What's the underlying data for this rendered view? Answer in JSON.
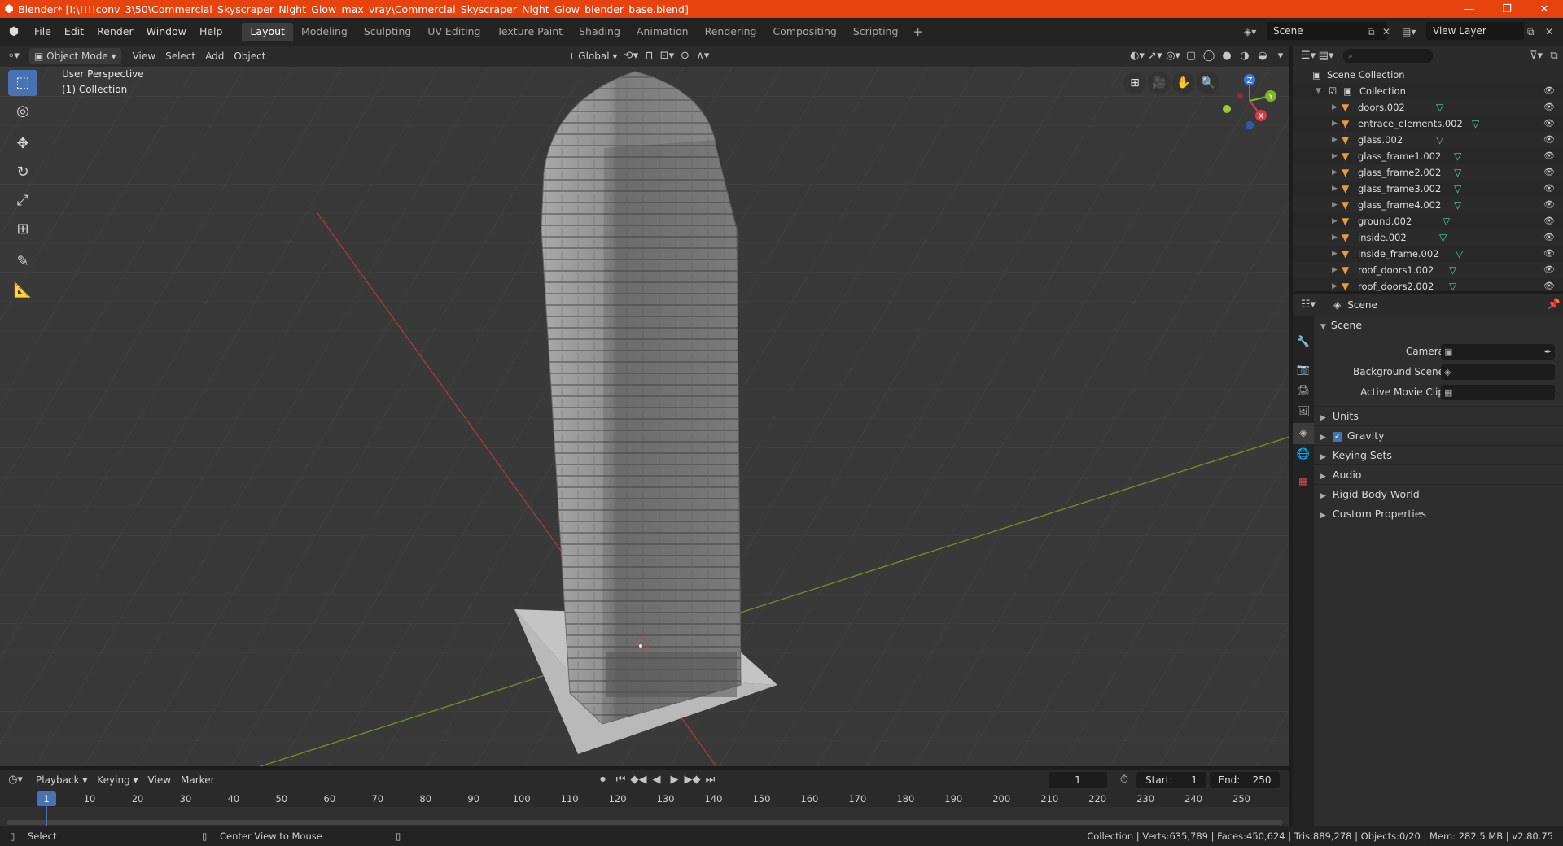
{
  "window": {
    "title": "Blender* [I:\\!!!!conv_3\\50\\Commercial_Skyscraper_Night_Glow_max_vray\\Commercial_Skyscraper_Night_Glow_blender_base.blend]",
    "icons": [
      "blender-logo-icon",
      "minimize-icon",
      "maximize-icon",
      "close-icon"
    ],
    "accent_color": "#e8420f"
  },
  "menubar": {
    "items": [
      "File",
      "Edit",
      "Render",
      "Window",
      "Help"
    ],
    "workspaces": [
      "Layout",
      "Modeling",
      "Sculpting",
      "UV Editing",
      "Texture Paint",
      "Shading",
      "Animation",
      "Rendering",
      "Compositing",
      "Scripting"
    ],
    "active_workspace": "Layout",
    "scene": "Scene",
    "view_layer": "View Layer"
  },
  "viewport_header": {
    "mode": "Object Mode",
    "menus": [
      "View",
      "Select",
      "Add",
      "Object"
    ],
    "transform_orientation": "Global"
  },
  "viewport": {
    "view_name": "User Perspective",
    "collection_label": "(1) Collection",
    "active_tool": "select-box",
    "gizmo_axes": [
      "X",
      "Y",
      "Z"
    ]
  },
  "outliner": {
    "root": "Scene Collection",
    "collection": "Collection",
    "objects": [
      "doors.002",
      "entrace_elements.002",
      "glass.002",
      "glass_frame1.002",
      "glass_frame2.002",
      "glass_frame3.002",
      "glass_frame4.002",
      "ground.002",
      "inside.002",
      "inside_frame.002",
      "roof_doors1.002",
      "roof_doors2.002"
    ]
  },
  "properties": {
    "context": "Scene",
    "panel_title": "Scene",
    "fields": [
      {
        "label": "Camera",
        "value": ""
      },
      {
        "label": "Background Scene",
        "value": ""
      },
      {
        "label": "Active Movie Clip",
        "value": ""
      }
    ],
    "subpanels": [
      "Units",
      "Gravity",
      "Keying Sets",
      "Audio",
      "Rigid Body World",
      "Custom Properties"
    ],
    "gravity_enabled": true
  },
  "timeline": {
    "menus": [
      "Playback",
      "Keying",
      "View",
      "Marker"
    ],
    "current_frame": "1",
    "start_label": "Start:",
    "start": "1",
    "end_label": "End:",
    "end": "250",
    "ruler_ticks": [
      "1",
      "10",
      "20",
      "30",
      "40",
      "50",
      "60",
      "70",
      "80",
      "90",
      "100",
      "110",
      "120",
      "130",
      "140",
      "150",
      "160",
      "170",
      "180",
      "190",
      "200",
      "210",
      "220",
      "230",
      "240",
      "250"
    ]
  },
  "statusbar": {
    "left_action": "Select",
    "middle_action": "Center View to Mouse",
    "stats": "Collection | Verts:635,789 | Faces:450,624 | Tris:889,278 | Objects:0/20 | Mem: 282.5 MB | v2.80.75"
  }
}
